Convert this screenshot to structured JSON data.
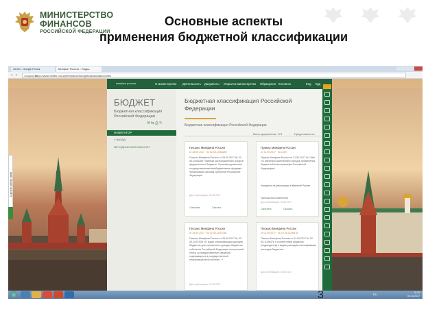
{
  "header": {
    "ministry_line1": "МИНИСТЕРСТВО",
    "ministry_line2": "ФИНАНСОВ",
    "ministry_line3": "РОССИЙСКОЙ ФЕДЕРАЦИИ",
    "title_line1": "Основные аспекты",
    "title_line2": "применения бюджетной классификации",
    "page_number": "3"
  },
  "browser": {
    "tabs": [
      "minfin - Google Поиск",
      "Минфин России :: Бюдж..."
    ],
    "url": "https://www.minfin.ru/ru/perfomance/budget/classandaccounts/",
    "secure_label": "Защищено"
  },
  "site": {
    "logo": "минфин россии",
    "nav": [
      "О министерстве",
      "Деятельность",
      "Документы",
      "Открытое министерство",
      "Обращения",
      "Контакты"
    ],
    "lang": [
      "Eng",
      "Крд"
    ],
    "sidebar": {
      "title": "БЮДЖЕТ",
      "subtitle_line1": "Бюджетная классификация",
      "subtitle_line2": "Российской Федерации",
      "navigator": "НАВИГАТОР",
      "back_link": "< НАЗАД",
      "cabinet_link": "МЕТОДИЧЕСКИЙ КАБИНЕТ"
    },
    "content": {
      "title_line1": "Бюджетная классификация Российской",
      "title_line2": "Федерации",
      "subtitle": "Бюджетная классификация Российской Федерации",
      "count": "Всего документов: 173",
      "sort": "Представить по:"
    },
    "cards": [
      {
        "title": "Письмо Минфина России",
        "number": "от 28.09.2017 · № 02-05-10/63289",
        "body": "Письмо Минфина России от 28.09.2017 № 02-05-10/63289 Главным распорядителям средств федерального бюджета. Органам управления государственными внебюджетными фондами. Финансовым органам субъектов Российской Федерации",
        "registration": "",
        "attach": "",
        "published": "Дата публикации: 20.09.2017",
        "link_view": "Смотреть",
        "link_download": "Скачать"
      },
      {
        "title": "Приказ Минфина России",
        "number": "от 21.09.2017 · № 148н",
        "body": "Приказ Минфина России от 21.09.2017 № 148н «О внесении изменений в порядок применения бюджетной классификации Российской Федерации»",
        "registration": "Находится на регистрации в Минюсте России",
        "attach": "Приложения   Изменения",
        "published": "Дата публикации: 26.09.2017",
        "link_view": "Смотреть",
        "link_download": "Скачать"
      },
      {
        "title": "Письмо Минфина России",
        "number": "от 26.09.2017 · № 02-05-11/57036",
        "body": "Письмо Минфина России от 26.09.2017 № 02-05-11/57036 «О кодах классификации доходов бюджетов для отражения в доходах бюджетов субъектов Российской Федерации поступлений платы за предоставление сведений, содержащихся в государственной информационной системе...»",
        "registration": "",
        "attach": "",
        "published": "Дата публикации: 13.09.2017",
        "link_view": "",
        "link_download": ""
      },
      {
        "title": "Письмо Минфина России",
        "number": "от 01.09.2017 · № 02-05-11/56478",
        "body": "Письмо Минфина России от 01.09.2017 № 02-05-11/56478 о соответствии разделов (подразделов) и видов расходов классификации расходов бюджетов",
        "registration": "",
        "attach": "",
        "published": "Дата публикации: 05.09.2017",
        "link_view": "",
        "link_download": ""
      }
    ]
  },
  "side_widget": "Оцените работу сайта",
  "taskbar": {
    "lang": "RU",
    "time": "15:33",
    "date": "05.10.2017"
  },
  "colors": {
    "site_green": "#23613c",
    "accent_orange": "#e8a226",
    "ministry_green": "#3b5c38"
  }
}
